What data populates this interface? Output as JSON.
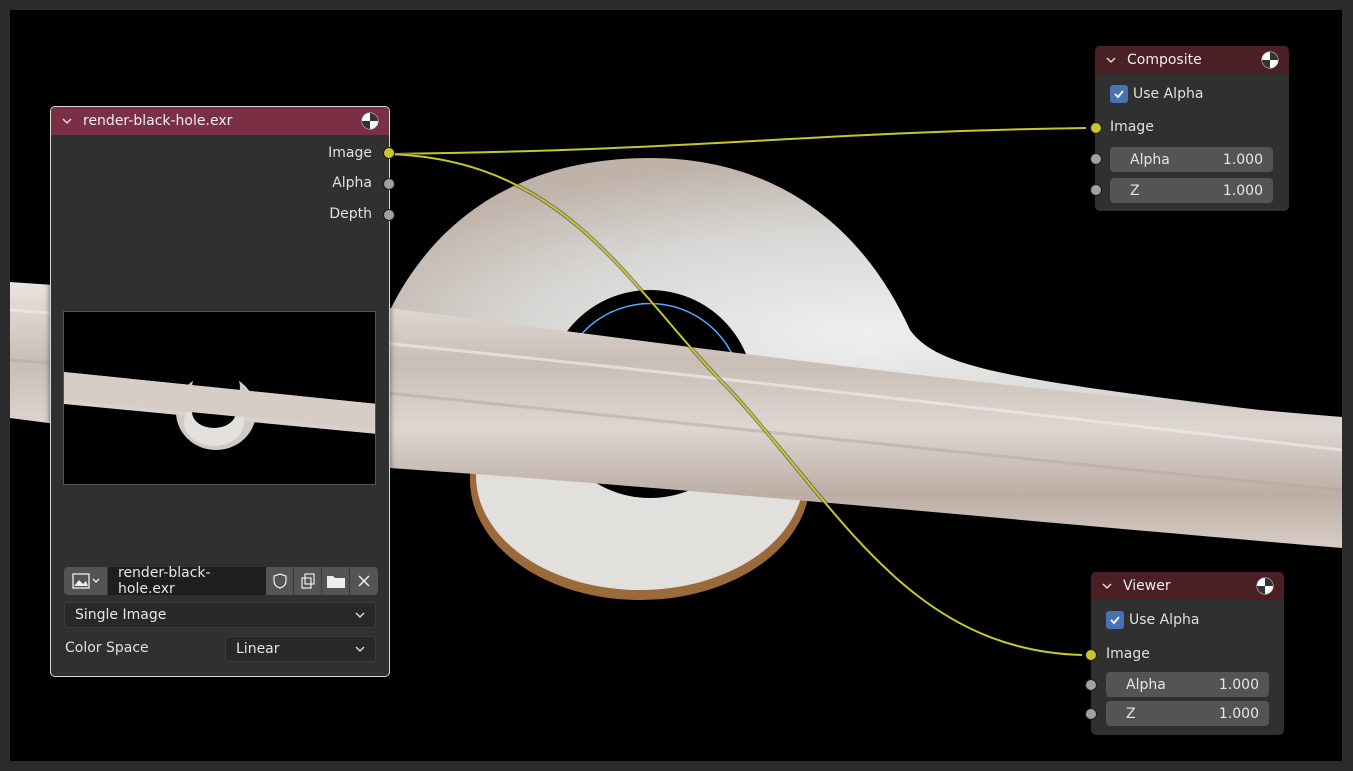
{
  "image_node": {
    "title": "render-black-hole.exr",
    "outputs": [
      "Image",
      "Alpha",
      "Depth"
    ],
    "file_name": "render-black-hole.exr",
    "source_type": "Single Image",
    "color_space_label": "Color Space",
    "color_space_value": "Linear"
  },
  "composite_node": {
    "title": "Composite",
    "use_alpha_label": "Use Alpha",
    "use_alpha_checked": true,
    "image_label": "Image",
    "alpha_label": "Alpha",
    "alpha_value": "1.000",
    "z_label": "Z",
    "z_value": "1.000"
  },
  "viewer_node": {
    "title": "Viewer",
    "use_alpha_label": "Use Alpha",
    "use_alpha_checked": true,
    "image_label": "Image",
    "alpha_label": "Alpha",
    "alpha_value": "1.000",
    "z_label": "Z",
    "z_value": "1.000"
  },
  "colors": {
    "image_header": "#7a2f45",
    "output_header": "#4a1f26",
    "wire": "#c7c729",
    "checkbox": "#4772b3"
  },
  "icons": [
    "chevron-down-icon",
    "material-sphere-icon",
    "image-browse-icon",
    "shield-icon",
    "duplicate-icon",
    "folder-icon",
    "close-icon"
  ]
}
